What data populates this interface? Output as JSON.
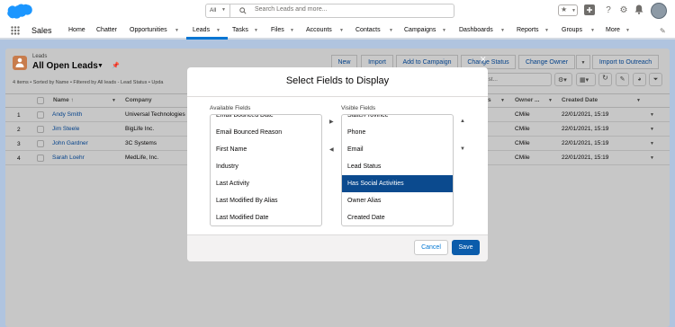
{
  "header": {
    "search_scope": "All",
    "search_placeholder": "Search Leads and more..."
  },
  "nav": {
    "app_name": "Sales",
    "items": [
      "Home",
      "Chatter",
      "Opportunities",
      "Leads",
      "Tasks",
      "Files",
      "Accounts",
      "Contacts",
      "Campaigns",
      "Dashboards",
      "Reports",
      "Groups",
      "More"
    ]
  },
  "list": {
    "object_label": "Leads",
    "view_name": "All Open Leads",
    "subtitle": "4 items • Sorted by Name • Filtered by All leads - Lead Status • Upda",
    "buttons": [
      "New",
      "Import",
      "Add to Campaign",
      "Change Status",
      "Change Owner",
      "Import to Outreach"
    ],
    "search_placeholder": "ist...",
    "columns": [
      "Name ↑",
      "Company",
      "s",
      "Owner ...",
      "Created Date"
    ],
    "rows": [
      {
        "num": "1",
        "name": "Andy Smith",
        "company": "Universal Technologies",
        "owner": "CMile",
        "created": "22/01/2021, 15:19"
      },
      {
        "num": "2",
        "name": "Jim Steele",
        "company": "BigLife Inc.",
        "owner": "CMile",
        "created": "22/01/2021, 15:19"
      },
      {
        "num": "3",
        "name": "John Gardner",
        "company": "3C Systems",
        "owner": "CMile",
        "created": "22/01/2021, 15:19"
      },
      {
        "num": "4",
        "name": "Sarah Loehr",
        "company": "MedLife, Inc.",
        "owner": "CMile",
        "created": "22/01/2021, 15:19"
      }
    ]
  },
  "modal": {
    "title": "Select Fields to Display",
    "available_label": "Available Fields",
    "visible_label": "Visible Fields",
    "available": [
      "Email Bounced Date",
      "Email Bounced Reason",
      "First Name",
      "Industry",
      "Last Activity",
      "Last Modified By Alias",
      "Last Modified Date"
    ],
    "visible": [
      "State/Province",
      "Phone",
      "Email",
      "Lead Status",
      "Has Social Activities",
      "Owner Alias",
      "Created Date"
    ],
    "selected_visible": "Has Social Activities",
    "cancel": "Cancel",
    "save": "Save"
  },
  "colors": {
    "brand_blue": "#0b5cab",
    "link_blue": "#04428a",
    "selected_item_bg": "#0b4a8e",
    "leads_icon_orange": "#c87c4c"
  }
}
